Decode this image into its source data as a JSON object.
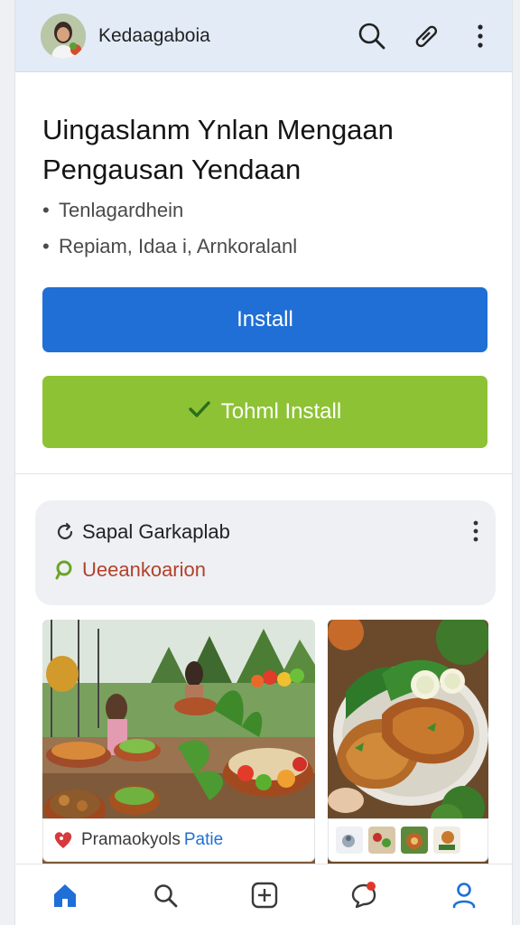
{
  "appbar": {
    "title": "Kedaagaboia",
    "icons": [
      "search-icon",
      "link-icon",
      "more-vert-icon"
    ]
  },
  "headline": {
    "line1": "Uingaslanm Ynlan Mengaan",
    "line2": "Pengausan Yendaan"
  },
  "bullets": [
    "Tenlagardhein",
    "Repiam, Idaa i, Arnkoralanl"
  ],
  "buttons": {
    "install_label": "Install",
    "tohmi_install_label": "Tohml Install"
  },
  "card": {
    "title": "Sapal Garkaplab",
    "subtitle": "Ueeankoarion"
  },
  "media": {
    "caption_part1": "Pramaokyols",
    "caption_part2": "Patie"
  },
  "colors": {
    "accent_blue": "#1f6fd6",
    "accent_green": "#8dc234",
    "header_bg": "#e3ebf7",
    "subtitle_red": "#b3402b"
  },
  "bottomnav": {
    "items": [
      "home-icon",
      "search-icon",
      "add-icon",
      "chat-icon",
      "profile-icon"
    ]
  }
}
